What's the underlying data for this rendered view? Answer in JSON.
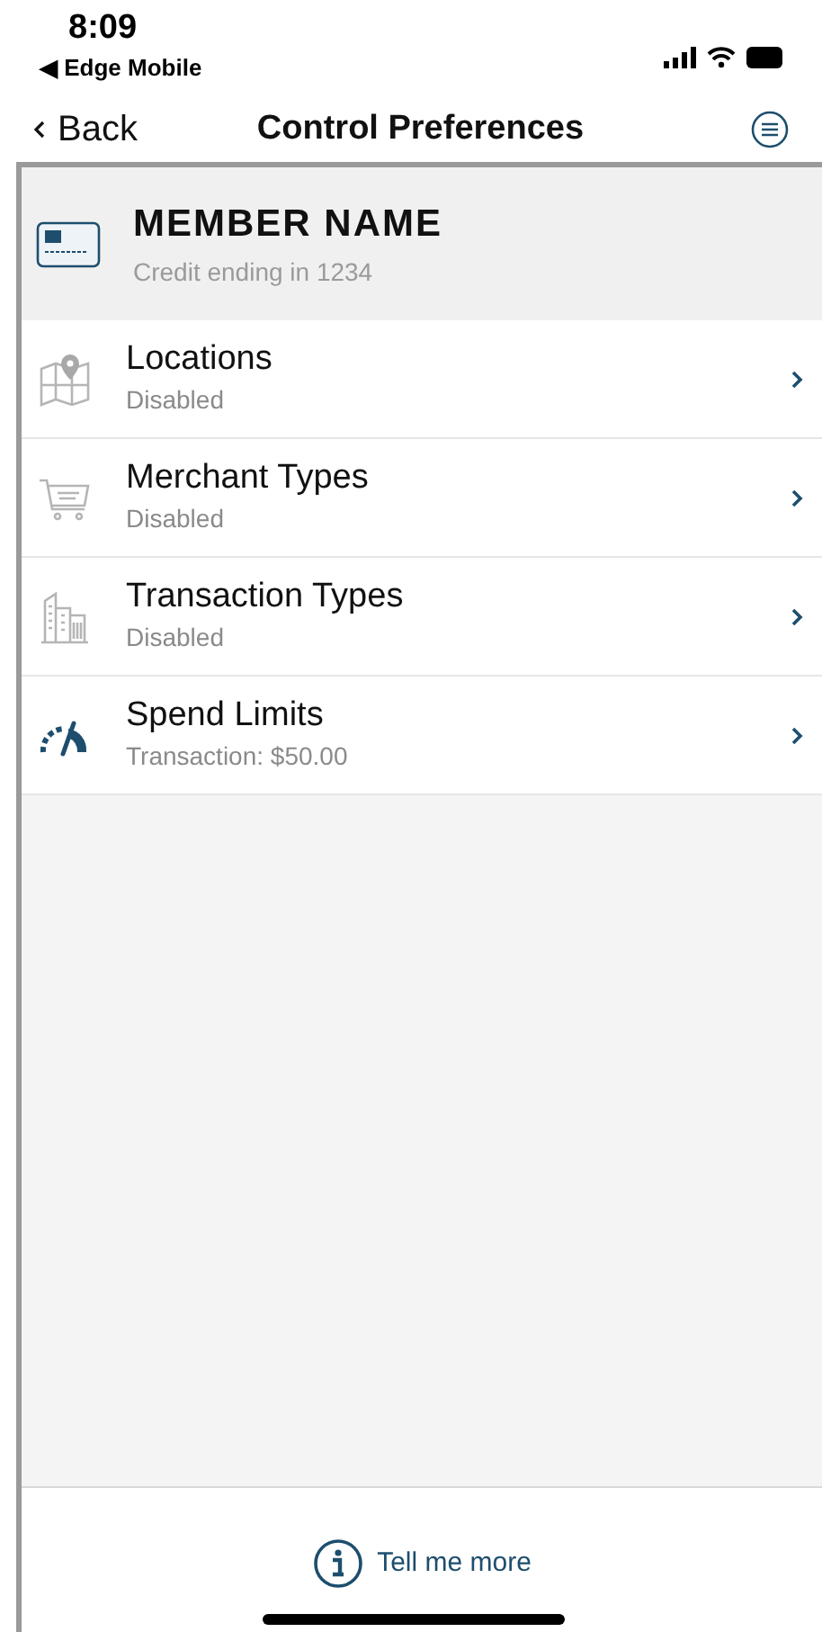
{
  "status_bar": {
    "time": "8:09",
    "back_app": "◀ Edge Mobile"
  },
  "nav": {
    "back": "Back",
    "title": "Control Preferences"
  },
  "card": {
    "name": "MEMBER NAME",
    "subtitle": "Credit ending in 1234"
  },
  "items": [
    {
      "kind": "map",
      "label": "Locations",
      "status": "Disabled"
    },
    {
      "kind": "cart",
      "label": "Merchant Types",
      "status": "Disabled"
    },
    {
      "kind": "building",
      "label": "Transaction Types",
      "status": "Disabled"
    },
    {
      "kind": "gauge",
      "label": "Spend Limits",
      "status": "Transaction: $50.00"
    }
  ],
  "footer": {
    "link": "Tell me more"
  }
}
